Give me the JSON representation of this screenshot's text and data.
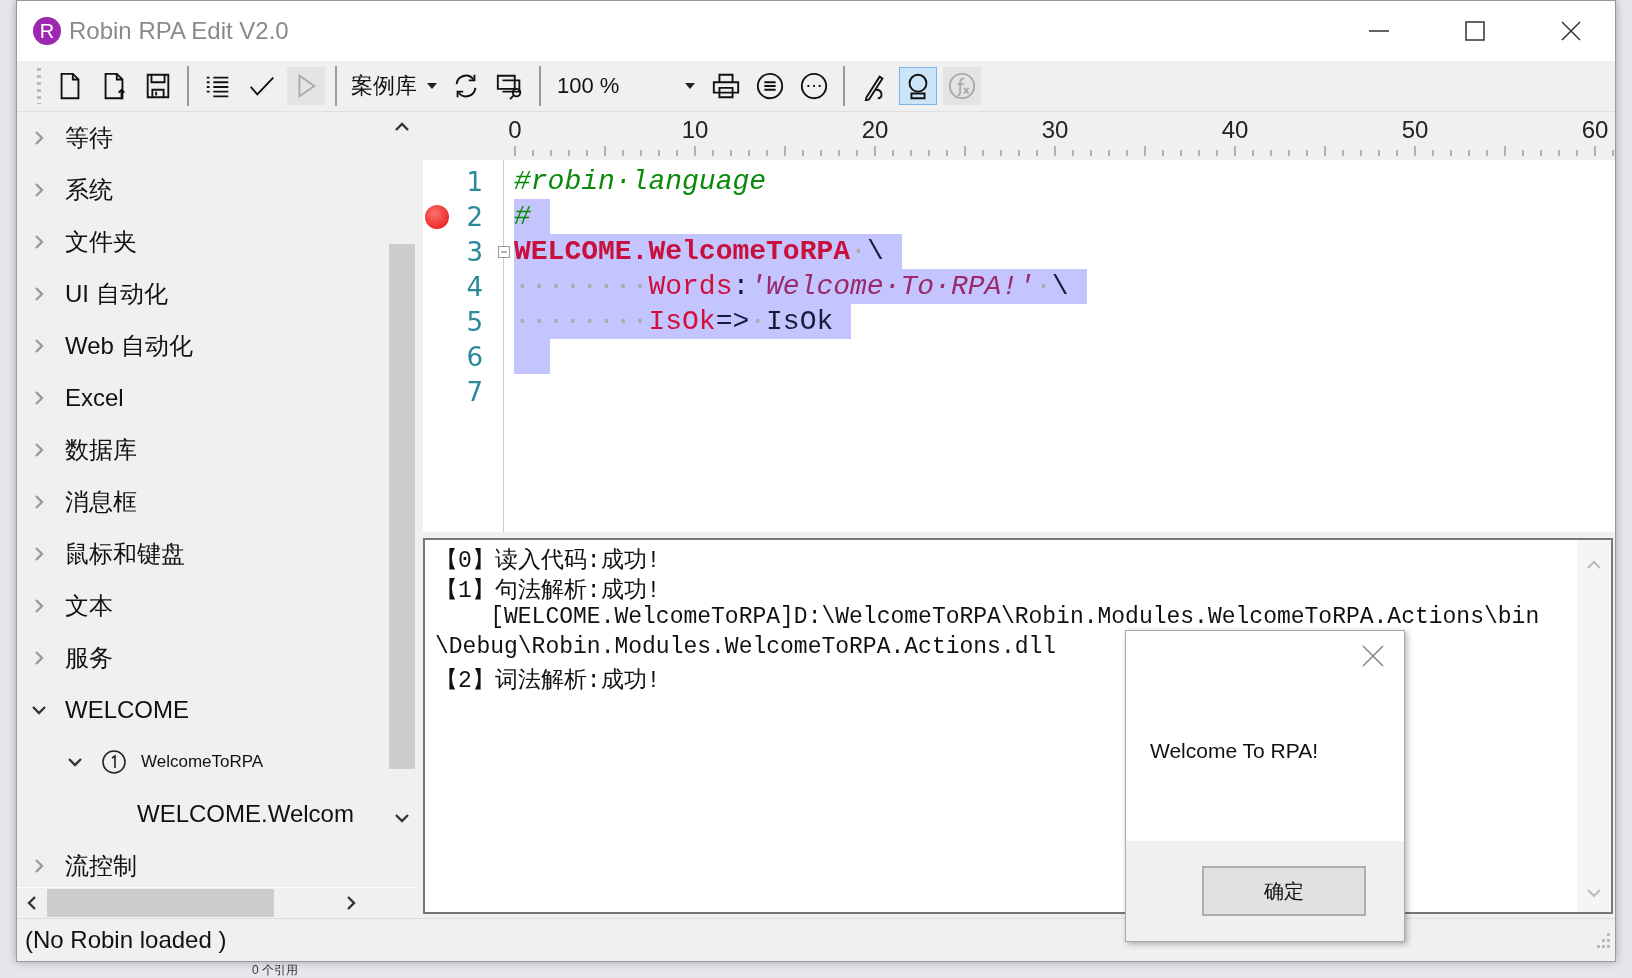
{
  "window": {
    "logo_letter": "R",
    "title": "Robin RPA Edit V2.0"
  },
  "toolbar": [
    {
      "kind": "button",
      "disabled": false,
      "selected": false
    },
    {
      "kind": "button",
      "disabled": false,
      "selected": false
    },
    {
      "kind": "button",
      "disabled": false,
      "selected": false
    },
    {
      "kind": "separator"
    },
    {
      "kind": "button",
      "disabled": false,
      "selected": false
    },
    {
      "kind": "button",
      "disabled": false,
      "selected": false
    },
    {
      "kind": "button",
      "disabled": true,
      "selected": false
    },
    {
      "kind": "separator"
    },
    {
      "kind": "dropdown",
      "label": "案例库"
    },
    {
      "kind": "button",
      "disabled": false,
      "selected": false
    },
    {
      "kind": "button",
      "disabled": false,
      "selected": false
    },
    {
      "kind": "separator"
    },
    {
      "kind": "combo",
      "value": "100 %"
    },
    {
      "kind": "button",
      "disabled": false,
      "selected": false
    },
    {
      "kind": "button",
      "disabled": false,
      "selected": false
    },
    {
      "kind": "button",
      "disabled": false,
      "selected": false
    },
    {
      "kind": "separator"
    },
    {
      "kind": "button",
      "disabled": false,
      "selected": false
    },
    {
      "kind": "button",
      "disabled": false,
      "selected": true
    },
    {
      "kind": "button",
      "disabled": true,
      "selected": false
    }
  ],
  "tree": [
    {
      "label": "等待",
      "expanded": false
    },
    {
      "label": "系统",
      "expanded": false
    },
    {
      "label": "文件夹",
      "expanded": false
    },
    {
      "label": "UI 自动化",
      "expanded": false
    },
    {
      "label": "Web 自动化",
      "expanded": false
    },
    {
      "label": "Excel",
      "expanded": false
    },
    {
      "label": "数据库",
      "expanded": false
    },
    {
      "label": "消息框",
      "expanded": false
    },
    {
      "label": "鼠标和键盘",
      "expanded": false
    },
    {
      "label": "文本",
      "expanded": false
    },
    {
      "label": "服务",
      "expanded": false
    },
    {
      "label": "WELCOME",
      "expanded": true,
      "children": [
        {
          "label": "WelcomeToRPA",
          "expanded": true,
          "children": [
            {
              "label": "WELCOME.Welcom"
            }
          ]
        }
      ]
    },
    {
      "label": "流控制",
      "expanded": false
    }
  ],
  "ruler": {
    "labels": [
      "0",
      "10",
      "20",
      "30",
      "40",
      "50",
      "60"
    ]
  },
  "editor": {
    "lines": [
      {
        "number": "1",
        "selected": false,
        "breakpoint": false,
        "fold": false,
        "tokens": [
          {
            "kind": "comment",
            "text": "#robin·language"
          }
        ]
      },
      {
        "number": "2",
        "selected": true,
        "breakpoint": true,
        "fold": false,
        "tokens": [
          {
            "kind": "comment",
            "text": "#"
          }
        ]
      },
      {
        "number": "3",
        "selected": true,
        "breakpoint": false,
        "fold": true,
        "tokens": [
          {
            "kind": "keyword",
            "text": "WELCOME.WelcomeToRPA"
          },
          {
            "kind": "ws",
            "text": "·"
          },
          {
            "kind": "plain",
            "text": "\\"
          }
        ]
      },
      {
        "number": "4",
        "selected": true,
        "breakpoint": false,
        "fold": false,
        "tokens": [
          {
            "kind": "ws",
            "text": "········"
          },
          {
            "kind": "param",
            "text": "Words"
          },
          {
            "kind": "plain",
            "text": ":"
          },
          {
            "kind": "string",
            "text": "'Welcome·To·RPA!'"
          },
          {
            "kind": "ws",
            "text": "·"
          },
          {
            "kind": "plain",
            "text": "\\"
          }
        ]
      },
      {
        "number": "5",
        "selected": true,
        "breakpoint": false,
        "fold": false,
        "tokens": [
          {
            "kind": "ws",
            "text": "········"
          },
          {
            "kind": "param",
            "text": "IsOk"
          },
          {
            "kind": "plain",
            "text": "=>"
          },
          {
            "kind": "ws",
            "text": "·"
          },
          {
            "kind": "plain",
            "text": "IsOk"
          }
        ]
      },
      {
        "number": "6",
        "selected": true,
        "breakpoint": false,
        "fold": false
      },
      {
        "number": "7",
        "selected": false,
        "breakpoint": false,
        "fold": false
      }
    ]
  },
  "output": {
    "lines": [
      "【0】读入代码:成功!",
      "【1】句法解析:成功!",
      "    [WELCOME.WelcomeToRPA]D:\\WelcomeToRPA\\Robin.Modules.WelcomeToRPA.Actions\\bin",
      "\\Debug\\Robin.Modules.WelcomeToRPA.Actions.dll",
      "【2】词法解析:成功!"
    ]
  },
  "dialog": {
    "message": "Welcome To RPA!",
    "button": "确定"
  },
  "status_bar": {
    "text": "(No Robin loaded )"
  },
  "backdrop": {
    "text": "0 个引用"
  }
}
